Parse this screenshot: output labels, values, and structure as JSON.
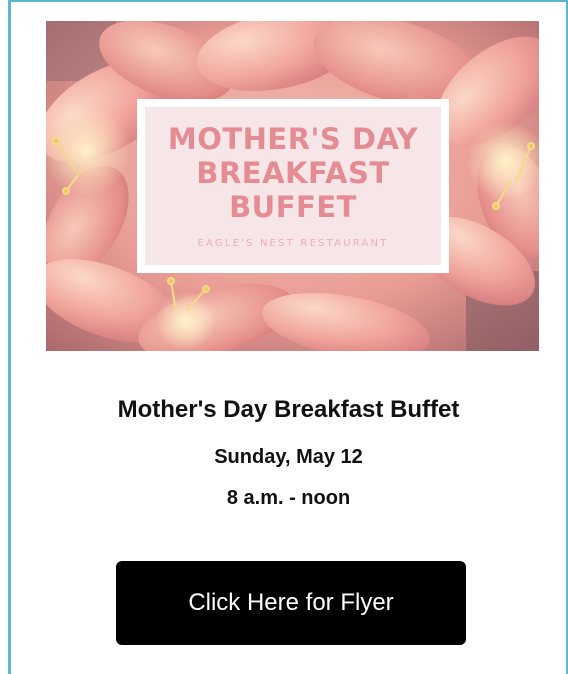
{
  "hero": {
    "title": "MOTHER'S DAY\nBREAKFAST\nBUFFET",
    "subtitle": "EAGLE'S NEST RESTAURANT"
  },
  "event": {
    "title": "Mother's Day Breakfast Buffet",
    "date": "Sunday, May 12",
    "time": "8 a.m. - noon"
  },
  "cta": {
    "label": "Click Here for Flyer"
  },
  "colors": {
    "border": "#5bb8cf",
    "hero_text": "#e48b93",
    "button_bg": "#000000",
    "button_text": "#ffffff"
  }
}
